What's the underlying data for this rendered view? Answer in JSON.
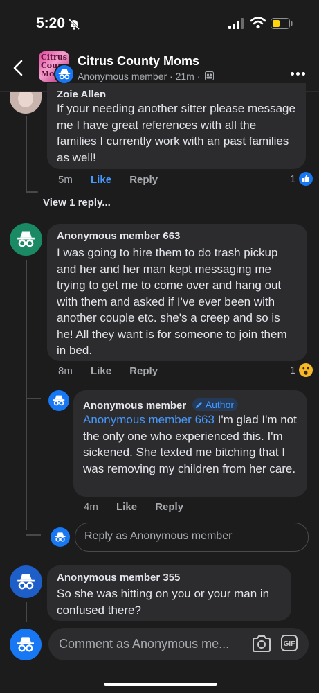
{
  "status_bar": {
    "time": "5:20"
  },
  "header": {
    "group_name": "Citrus County Moms",
    "subtitle": "Anonymous member · 21m ·",
    "group_image_text": [
      "Citrus",
      "Coun",
      "Mo"
    ]
  },
  "comments": [
    {
      "author": "Zoie Allen",
      "text": "If your needing another sitter please message me I have great references with all the families I currently work with an past families as well!",
      "time": "5m",
      "like_label": "Like",
      "reply_label": "Reply",
      "reaction_count": "1",
      "reaction": "like-icon"
    },
    {
      "author": "Anonymous member 663",
      "text": "I was going to hire them to do trash pickup and her and her man kept messaging me trying to get me to come over and hang out with them and asked if I've ever been with another couple etc. she's a creep and so is he! All they want is for someone to join them in bed.",
      "time": "8m",
      "like_label": "Like",
      "reply_label": "Reply",
      "reaction_count": "1",
      "reaction": "wow-icon"
    },
    {
      "author": "Anonymous member 355",
      "text": "So she was hitting on you or your man in confused there?"
    }
  ],
  "view_replies": "View 1 reply...",
  "reply": {
    "author": "Anonymous member",
    "author_badge": "Author",
    "mention": "Anonymous member 663",
    "text": " I'm glad I'm not the only one who experienced this. I'm sickened. She texted me bitching that I was removing my children from her care.",
    "time": "4m",
    "like_label": "Like",
    "reply_label": "Reply"
  },
  "reply_input": {
    "placeholder": "Reply as Anonymous member"
  },
  "comment_input": {
    "placeholder": "Comment as Anonymous me..."
  },
  "colors": {
    "background": "#1c1c1d",
    "bubble": "#2c2c2e",
    "link": "#4599ff",
    "accent": "#1877f2"
  }
}
